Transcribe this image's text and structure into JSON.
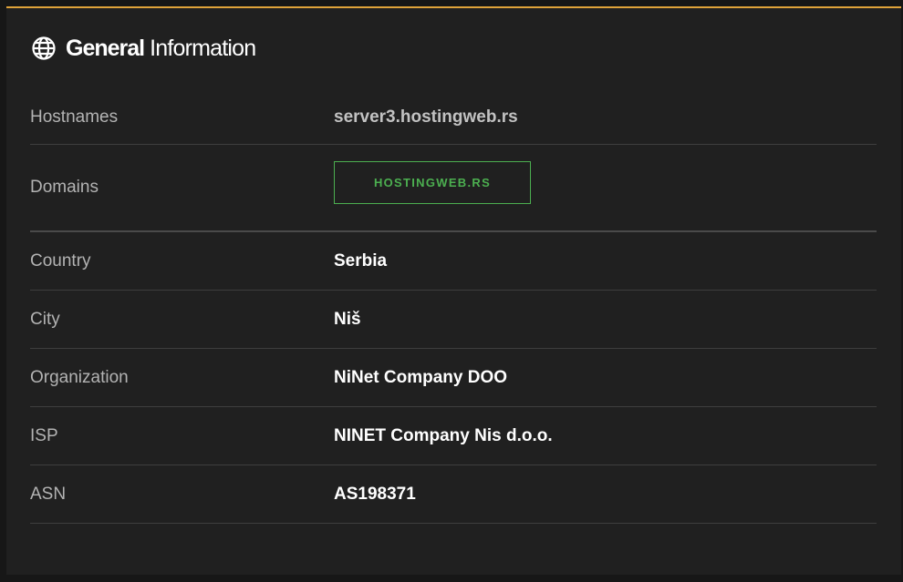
{
  "header": {
    "title_strong": "General",
    "title_light": "Information",
    "icon": "globe-icon"
  },
  "rows": {
    "hostnames": {
      "label": "Hostnames",
      "value": "server3.hostingweb.rs"
    },
    "domains": {
      "label": "Domains",
      "badge": "HOSTINGWEB.RS"
    },
    "country": {
      "label": "Country",
      "value": "Serbia"
    },
    "city": {
      "label": "City",
      "value": "Niš"
    },
    "organization": {
      "label": "Organization",
      "value": "NiNet Company DOO"
    },
    "isp": {
      "label": "ISP",
      "value": "NINET Company Nis d.o.o."
    },
    "asn": {
      "label": "ASN",
      "value": "AS198371"
    }
  },
  "colors": {
    "accent": "#e0a33a",
    "badge": "#4caf50",
    "background": "#202020"
  }
}
